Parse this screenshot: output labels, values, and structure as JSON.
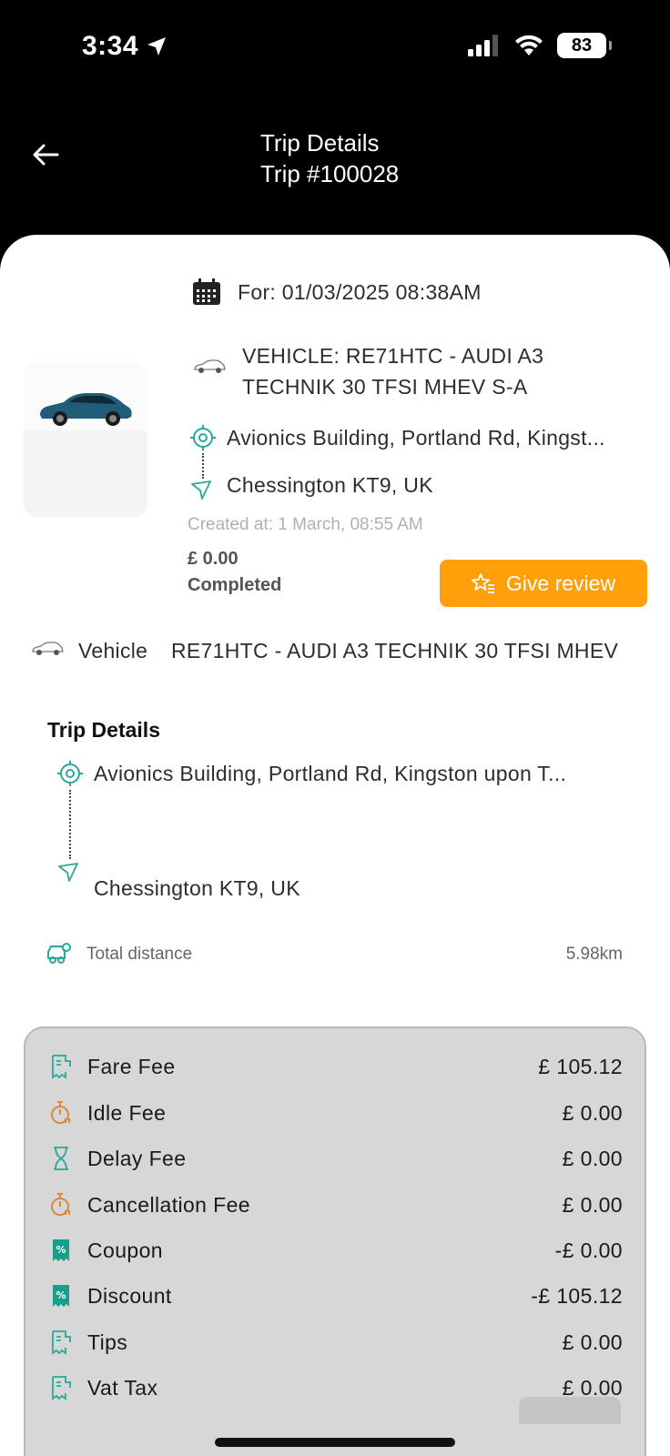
{
  "status_bar": {
    "time": "3:34",
    "battery": "83"
  },
  "header": {
    "title": "Trip Details",
    "subtitle": "Trip #100028"
  },
  "summary": {
    "scheduled_for": "For: 01/03/2025 08:38AM",
    "vehicle_line1": "VEHICLE: RE71HTC - AUDI A3",
    "vehicle_line2": "TECHNIK 30 TFSI MHEV S-A",
    "pickup": "Avionics Building, Portland Rd, Kingst...",
    "dropoff": "Chessington KT9, UK",
    "created_at": "Created at: 1 March, 08:55 AM",
    "price": "£ 0.00",
    "status": "Completed",
    "review_button": "Give review"
  },
  "vehicle_row": {
    "label": "Vehicle",
    "value": "RE71HTC - AUDI A3 TECHNIK 30 TFSI MHEV"
  },
  "trip_details": {
    "title": "Trip Details",
    "pickup": "Avionics Building, Portland Rd, Kingston upon T...",
    "dropoff": "Chessington KT9, UK",
    "distance_label": "Total distance",
    "distance_value": "5.98km"
  },
  "fees": [
    {
      "label": "Fare Fee",
      "value": "£ 105.12",
      "icon": "receipt-icon"
    },
    {
      "label": "Idle Fee",
      "value": "£ 0.00",
      "icon": "timer-icon"
    },
    {
      "label": "Delay Fee",
      "value": "£ 0.00",
      "icon": "hourglass-icon"
    },
    {
      "label": "Cancellation Fee",
      "value": "£ 0.00",
      "icon": "timer-icon"
    },
    {
      "label": "Coupon",
      "value": "-£ 0.00",
      "icon": "coupon-icon"
    },
    {
      "label": "Discount",
      "value": "-£ 105.12",
      "icon": "coupon-icon"
    },
    {
      "label": "Tips",
      "value": "£ 0.00",
      "icon": "receipt-icon"
    },
    {
      "label": "Vat Tax",
      "value": "£ 0.00",
      "icon": "receipt-icon"
    }
  ],
  "colors": {
    "accent": "#ff9f0a",
    "teal": "#29a89a",
    "orange_icon": "#d98a3c"
  }
}
